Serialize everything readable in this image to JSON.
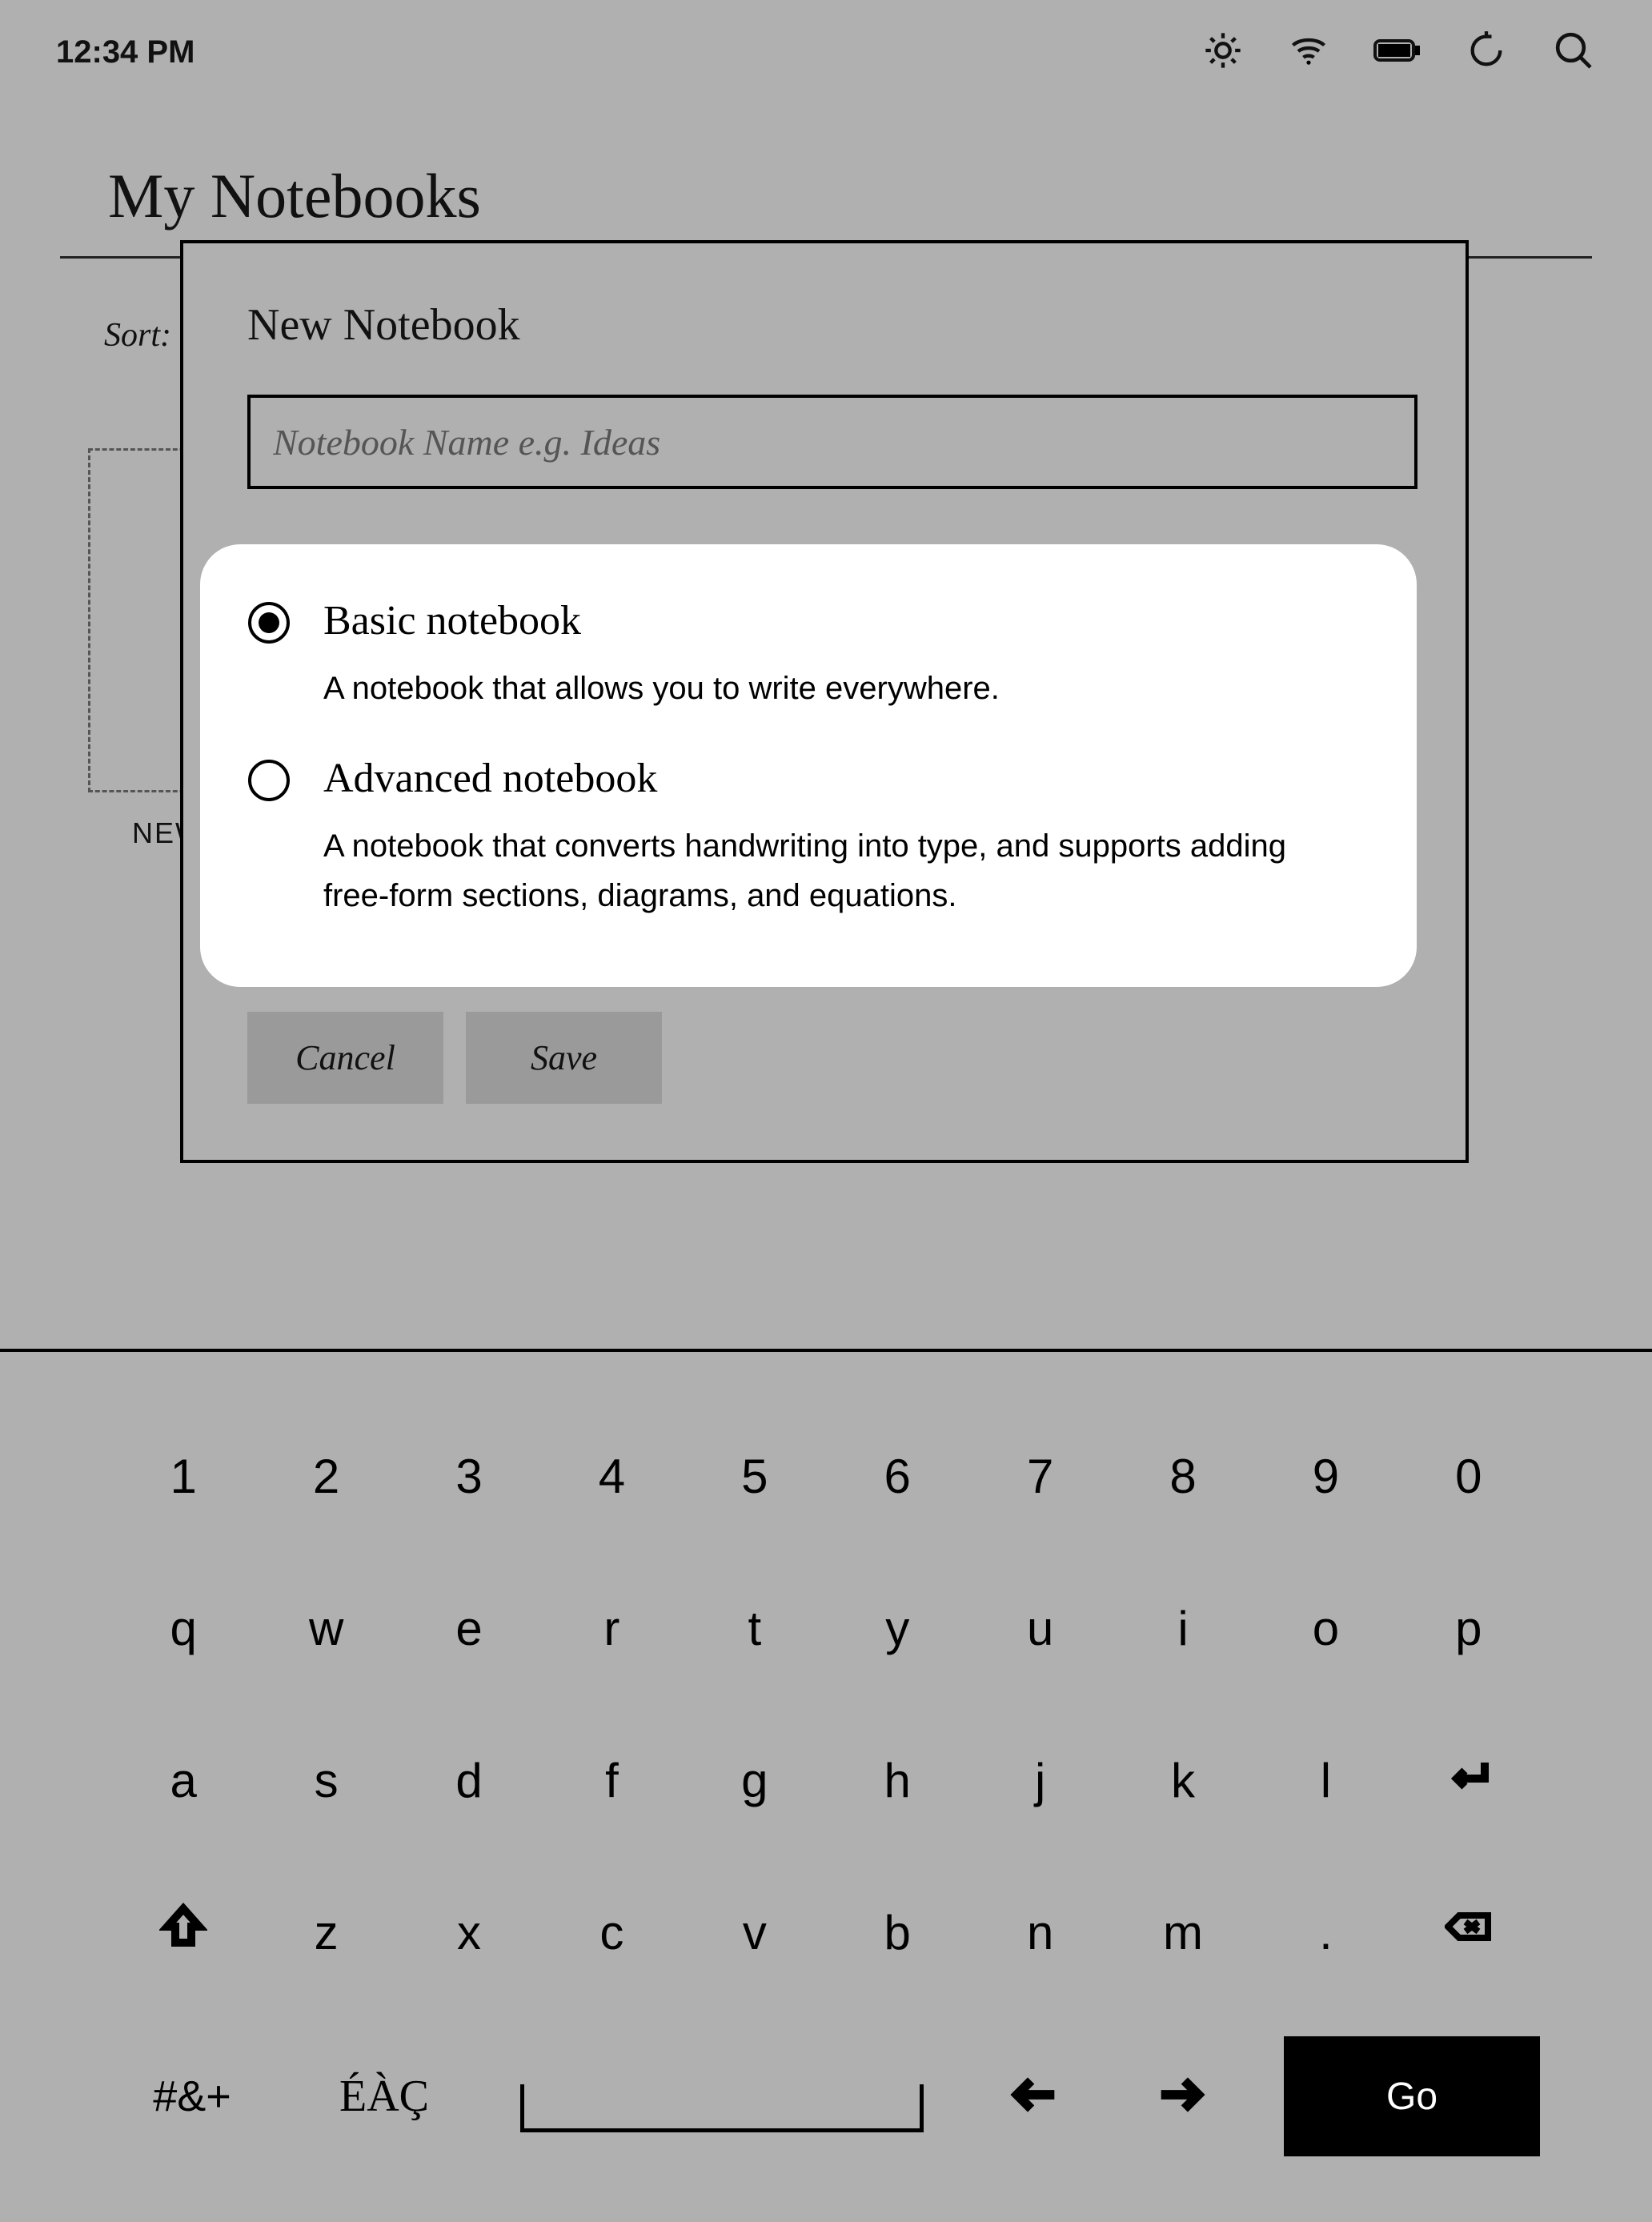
{
  "status": {
    "time": "12:34 PM"
  },
  "page": {
    "title": "My Notebooks",
    "sort_label": "Sort:",
    "new_label": "NEW"
  },
  "dialog": {
    "title": "New Notebook",
    "name_placeholder": "Notebook Name e.g. Ideas",
    "name_value": "",
    "options": [
      {
        "title": "Basic notebook",
        "desc": "A notebook that allows you to write everywhere.",
        "selected": true
      },
      {
        "title": "Advanced notebook",
        "desc": "A notebook that converts handwriting into type, and supports adding free-form sections, diagrams, and equations.",
        "selected": false
      }
    ],
    "cancel": "Cancel",
    "save": "Save"
  },
  "keyboard": {
    "row1": [
      "1",
      "2",
      "3",
      "4",
      "5",
      "6",
      "7",
      "8",
      "9",
      "0"
    ],
    "row2": [
      "q",
      "w",
      "e",
      "r",
      "t",
      "y",
      "u",
      "i",
      "o",
      "p"
    ],
    "row3": [
      "a",
      "s",
      "d",
      "f",
      "g",
      "h",
      "j",
      "k",
      "l",
      "↵"
    ],
    "row4": [
      "⇧",
      "z",
      "x",
      "c",
      "v",
      "b",
      "n",
      "m",
      ".",
      "⌫"
    ],
    "sym": "#&+",
    "accent": "ÉÀÇ",
    "go": "Go"
  }
}
